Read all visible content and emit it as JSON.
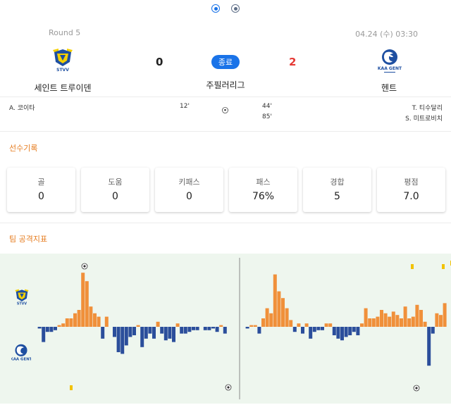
{
  "pager": {
    "count": 2,
    "active_index": 0
  },
  "match": {
    "round": "Round 5",
    "datetime": "04.24 (수) 03:30",
    "status": "종료",
    "league": "주필러리그",
    "home": {
      "name": "세인트 트루이덴",
      "score": "0",
      "logo_text": "STVV",
      "color": "#f5d000"
    },
    "away": {
      "name": "헨트",
      "score": "2",
      "logo_text": "KAA GENT",
      "color": "#1e4fa1"
    }
  },
  "goals": {
    "home": [
      {
        "player": "A. 코이타",
        "minute": "12'"
      }
    ],
    "away_minutes": [
      "44'",
      "85'"
    ],
    "away_players": [
      "T. 티수달리",
      "S. 미트로비치"
    ]
  },
  "player_record": {
    "title": "선수기록",
    "stats": [
      {
        "label": "골",
        "value": "0"
      },
      {
        "label": "도움",
        "value": "0"
      },
      {
        "label": "키패스",
        "value": "0"
      },
      {
        "label": "패스",
        "value": "76%"
      },
      {
        "label": "경합",
        "value": "5"
      },
      {
        "label": "평점",
        "value": "7.0"
      }
    ]
  },
  "attack_index": {
    "title": "팀 공격지표",
    "colors": {
      "home": "#f0903a",
      "away": "#2b4e9b",
      "background": "#eef6ee"
    },
    "chart_data": {
      "type": "bar",
      "series": [
        {
          "half": 1,
          "values": [
            0,
            -1,
            -9,
            -3,
            -3,
            -2,
            1,
            2,
            5,
            5,
            8,
            10,
            32,
            27,
            12,
            8,
            6,
            -7,
            6,
            0,
            -6,
            -15,
            -16,
            -11,
            -6,
            -5,
            1,
            -12,
            -7,
            -4,
            -7,
            3,
            -4,
            -8,
            -7,
            -9,
            2,
            -4,
            -4,
            -3,
            -2,
            -2,
            0,
            -2,
            -2,
            -1,
            -3,
            1,
            -4
          ]
        },
        {
          "half": 2,
          "values": [
            0,
            -1,
            1,
            1,
            -4,
            5,
            11,
            8,
            31,
            21,
            17,
            11,
            4,
            -3,
            2,
            -4,
            2,
            -7,
            -3,
            -2,
            -2,
            2,
            2,
            -5,
            -7,
            -8,
            -6,
            -5,
            -3,
            -5,
            2,
            11,
            5,
            5,
            6,
            10,
            8,
            6,
            9,
            7,
            5,
            12,
            5,
            6,
            13,
            10,
            3,
            -23,
            -4,
            8,
            7,
            14
          ]
        }
      ],
      "events": [
        {
          "team": "home",
          "half": 1,
          "type": "goal",
          "icon": "soccer-ball-icon"
        },
        {
          "team": "away",
          "half": 1,
          "type": "goal",
          "icon": "soccer-ball-icon"
        },
        {
          "team": "away",
          "half": 2,
          "type": "goal",
          "icon": "soccer-ball-icon"
        },
        {
          "team": "away",
          "half": 1,
          "type": "yellow-card",
          "icon": "yellow-card-icon"
        },
        {
          "team": "home",
          "half": 2,
          "type": "yellow-card",
          "icon": "yellow-card-icon"
        },
        {
          "team": "home",
          "half": 2,
          "type": "yellow-card",
          "icon": "yellow-card-icon"
        },
        {
          "team": "away",
          "half": 2,
          "type": "yellow-card",
          "icon": "yellow-card-icon"
        }
      ]
    }
  },
  "icons": {
    "goal_separator": "soccer-ball-icon",
    "home_logo": "stvv-crest-icon",
    "away_logo": "kaa-gent-crest-icon"
  }
}
